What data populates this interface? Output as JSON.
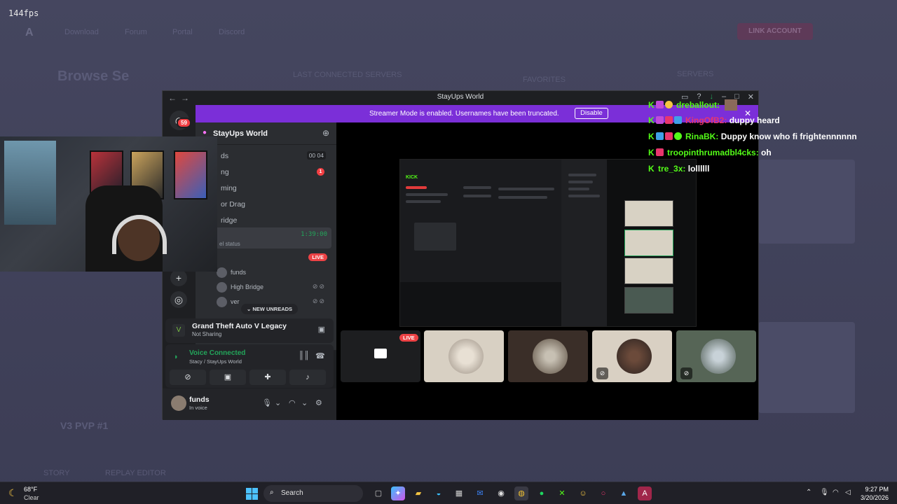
{
  "overlay": {
    "fps": "144fps"
  },
  "discord": {
    "window_title": "StayUps World",
    "streamer_banner": {
      "text": "Streamer Mode is enabled. Usernames have been truncated.",
      "button": "Disable"
    },
    "guild_badge": "59",
    "server": {
      "name": "StayUps World"
    },
    "channels": [
      {
        "label": "ds",
        "count_a": "00",
        "count_b": "04"
      },
      {
        "label": "ng",
        "badge": "1"
      },
      {
        "label": "ming"
      },
      {
        "label": "or Drag"
      },
      {
        "label": "ridge"
      }
    ],
    "voice_box": {
      "timer": "1:39:00",
      "status": "el status"
    },
    "live_label": "LIVE",
    "voice_users": [
      {
        "name": "funds"
      },
      {
        "name": "High Bridge"
      },
      {
        "name": "ver"
      }
    ],
    "new_unreads": "NEW UNREADS",
    "activity": {
      "title": "Grand Theft Auto V Legacy",
      "subtitle": "Not Sharing"
    },
    "rtc": {
      "title": "Voice Connected",
      "subtitle": "Stacy / StayUps World"
    },
    "user": {
      "name": "funds",
      "status": "In voice"
    },
    "stream_kick_label": "KICK",
    "tile_live": "LIVE"
  },
  "chat": [
    {
      "user": "dreballout",
      "sep": ":",
      "msg": "",
      "user_color": "#53fc18"
    },
    {
      "user": "KingOfB2",
      "sep": ":",
      "msg": "duppy heard",
      "user_color": "#e8366d"
    },
    {
      "user": "RinaBK",
      "sep": ":",
      "msg": "Duppy know who fi frightennnnnn",
      "user_color": "#53fc18"
    },
    {
      "user": "troopinthrumadbl4cks",
      "sep": ":",
      "msg": "oh",
      "user_color": "#53fc18"
    },
    {
      "user": "tre_3x",
      "sep": ":",
      "msg": "lollllll",
      "user_color": "#53fc18"
    }
  ],
  "taskbar": {
    "weather": {
      "temp": "68°F",
      "desc": "Clear"
    },
    "search_label": "Search",
    "time": "9:27 PM",
    "date": "3/20/2026"
  },
  "background": {
    "nav": [
      "Download",
      "Forum",
      "Portal",
      "Discord"
    ],
    "link_button": "LINK ACCOUNT",
    "headings": [
      "Browse Se",
      "LAST CONNECTED SERVERS",
      "FAVORITES",
      "SERVERS"
    ],
    "server_title": "V3 PVP #1",
    "buttons": [
      "STORY",
      "REPLAY EDITOR"
    ]
  },
  "colors": {
    "accent": "#7b2fd8",
    "kick_green": "#53fc18",
    "live_red": "#ed4245",
    "voice_green": "#23a55a"
  }
}
